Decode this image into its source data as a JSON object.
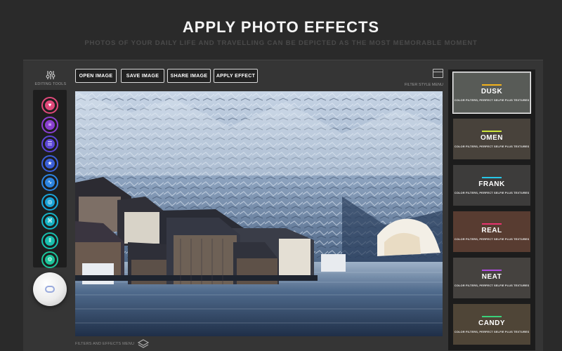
{
  "hero": {
    "title": "APPLY PHOTO EFFECTS",
    "subtitle": "PHOTOS OF YOUR DAILY LIFE AND TRAVELLING CAN BE DEPICTED AS THE MOST MEMORABLE MOMENT"
  },
  "sidebar": {
    "label": "EDITING TOOLS",
    "tools": [
      {
        "name": "heart-icon",
        "glyph": "♥",
        "fill": "#e0497a"
      },
      {
        "name": "list-icon",
        "glyph": "≡",
        "fill": "#8a3fd0"
      },
      {
        "name": "adjust-icon",
        "glyph": "☰",
        "fill": "#5b46d6"
      },
      {
        "name": "star-icon",
        "glyph": "★",
        "fill": "#3b5fd8"
      },
      {
        "name": "trend-icon",
        "glyph": "∿",
        "fill": "#2c84e0"
      },
      {
        "name": "target-icon",
        "glyph": "◎",
        "fill": "#19a3d8"
      },
      {
        "name": "shapes-icon",
        "glyph": "⌘",
        "fill": "#16b3c4"
      },
      {
        "name": "bars-icon",
        "glyph": "⫴",
        "fill": "#18bfae"
      },
      {
        "name": "gear-icon",
        "glyph": "⚙",
        "fill": "#1dc49a"
      }
    ]
  },
  "toolbar": {
    "open_label": "OPEN IMAGE",
    "save_label": "SAVE IMAGE",
    "share_label": "SHARE IMAGE",
    "apply_label": "APPLY EFFECT"
  },
  "filter_style_menu_label": "FILTER STYLE MENU",
  "filters_effects_menu_label": "FILTERS AND EFFECTS MENU",
  "filters": [
    {
      "name": "DUSK",
      "desc": "COLOR FILTERS, PERFECT SELFIE PLUS TEXTURES",
      "accent": "#f2b21b",
      "bg": "#8a8f88",
      "selected": true
    },
    {
      "name": "OMEN",
      "desc": "COLOR FILTERS, PERFECT SELFIE PLUS TEXTURES",
      "accent": "#cde63a",
      "bg": "#6e6458",
      "selected": false
    },
    {
      "name": "FRANK",
      "desc": "COLOR FILTERS, PERFECT SELFIE PLUS TEXTURES",
      "accent": "#27c7e8",
      "bg": "#5c5a58",
      "selected": false
    },
    {
      "name": "REAL",
      "desc": "COLOR FILTERS, PERFECT SELFIE PLUS TEXTURES",
      "accent": "#e8336e",
      "bg": "#8a5a48",
      "selected": false
    },
    {
      "name": "NEAT",
      "desc": "COLOR FILTERS, PERFECT SELFIE PLUS TEXTURES",
      "accent": "#b04be0",
      "bg": "#6a6460",
      "selected": false
    },
    {
      "name": "CANDY",
      "desc": "COLOR FILTERS, PERFECT SELFIE PLUS TEXTURES",
      "accent": "#3ad27a",
      "bg": "#7a6a52",
      "selected": false
    }
  ]
}
